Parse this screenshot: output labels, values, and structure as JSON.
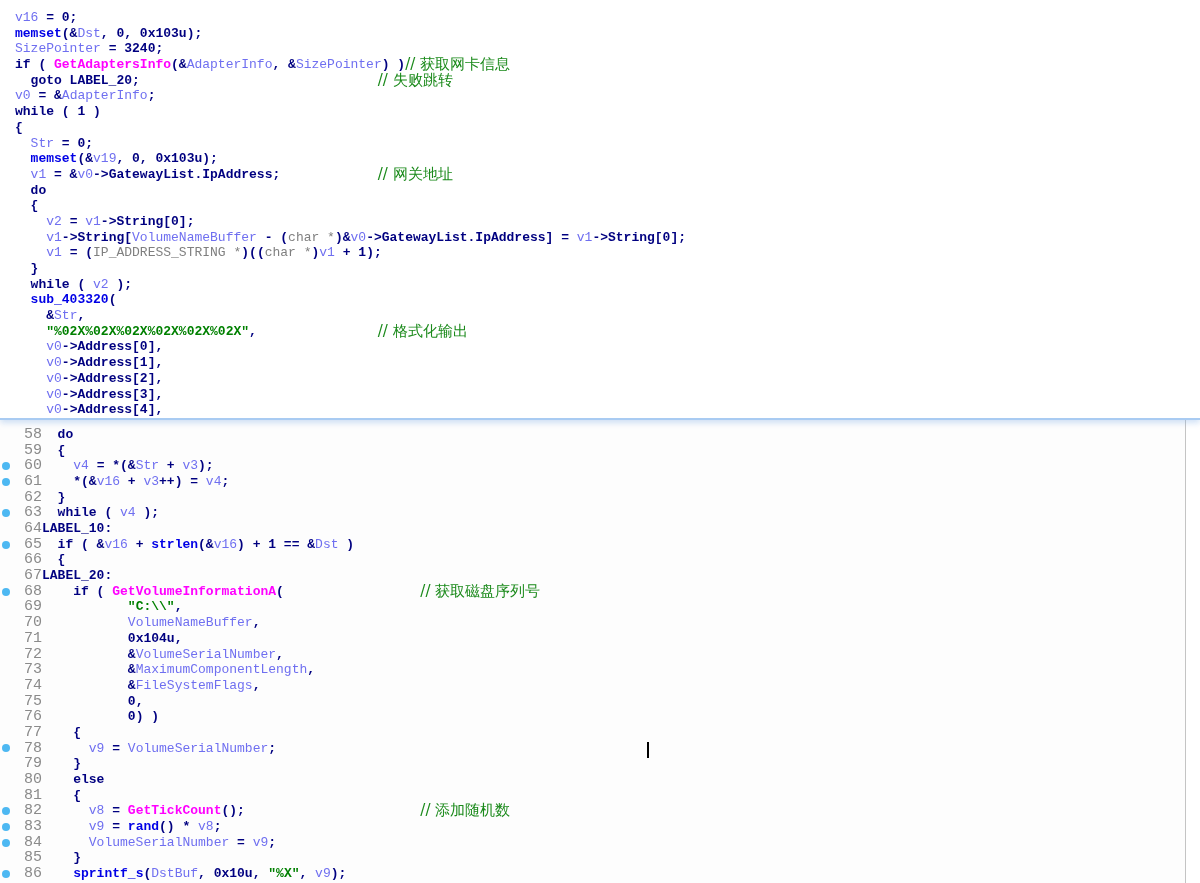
{
  "popup": {
    "lines": [
      {
        "code": [
          {
            "kind": "var",
            "text": "v16"
          },
          {
            "kind": "plain",
            "text": " = 0;"
          }
        ]
      },
      {
        "code": [
          {
            "kind": "func",
            "text": "memset"
          },
          {
            "kind": "plain",
            "text": "(&"
          },
          {
            "kind": "var",
            "text": "Dst"
          },
          {
            "kind": "plain",
            "text": ", 0, 0x103u);"
          }
        ]
      },
      {
        "code": [
          {
            "kind": "var",
            "text": "SizePointer"
          },
          {
            "kind": "plain",
            "text": " = 3240;"
          }
        ]
      },
      {
        "code": [
          {
            "kind": "plain",
            "text": "if ( "
          },
          {
            "kind": "import",
            "text": "GetAdaptersInfo"
          },
          {
            "kind": "plain",
            "text": "(&"
          },
          {
            "kind": "var",
            "text": "AdapterInfo"
          },
          {
            "kind": "plain",
            "text": ", &"
          },
          {
            "kind": "var",
            "text": "SizePointer"
          },
          {
            "kind": "plain",
            "text": ") )"
          }
        ],
        "comment": "// 获取网卡信息"
      },
      {
        "code": [
          {
            "kind": "plain",
            "text": "  goto LABEL_20;"
          }
        ],
        "comment": "// 失败跳转"
      },
      {
        "code": [
          {
            "kind": "var",
            "text": "v0"
          },
          {
            "kind": "plain",
            "text": " = &"
          },
          {
            "kind": "var",
            "text": "AdapterInfo"
          },
          {
            "kind": "plain",
            "text": ";"
          }
        ]
      },
      {
        "code": [
          {
            "kind": "plain",
            "text": "while ( 1 )"
          }
        ]
      },
      {
        "code": [
          {
            "kind": "plain",
            "text": "{"
          }
        ]
      },
      {
        "code": [
          {
            "kind": "var",
            "text": "  Str"
          },
          {
            "kind": "plain",
            "text": " = 0;"
          }
        ]
      },
      {
        "code": [
          {
            "kind": "func",
            "text": "  memset"
          },
          {
            "kind": "plain",
            "text": "(&"
          },
          {
            "kind": "var",
            "text": "v19"
          },
          {
            "kind": "plain",
            "text": ", 0, 0x103u);"
          }
        ]
      },
      {
        "code": [
          {
            "kind": "var",
            "text": "  v1"
          },
          {
            "kind": "plain",
            "text": " = &"
          },
          {
            "kind": "var",
            "text": "v0"
          },
          {
            "kind": "plain",
            "text": "->GatewayList.IpAddress;"
          }
        ],
        "comment": "// 网关地址"
      },
      {
        "code": [
          {
            "kind": "plain",
            "text": "  do"
          }
        ]
      },
      {
        "code": [
          {
            "kind": "plain",
            "text": "  {"
          }
        ]
      },
      {
        "code": [
          {
            "kind": "var",
            "text": "    v2"
          },
          {
            "kind": "plain",
            "text": " = "
          },
          {
            "kind": "var",
            "text": "v1"
          },
          {
            "kind": "plain",
            "text": "->String[0];"
          }
        ]
      },
      {
        "code": [
          {
            "kind": "var",
            "text": "    v1"
          },
          {
            "kind": "plain",
            "text": "->String["
          },
          {
            "kind": "var",
            "text": "VolumeNameBuffer"
          },
          {
            "kind": "plain",
            "text": " - ("
          },
          {
            "kind": "type",
            "text": "char *"
          },
          {
            "kind": "plain",
            "text": ")&"
          },
          {
            "kind": "var",
            "text": "v0"
          },
          {
            "kind": "plain",
            "text": "->GatewayList.IpAddress] = "
          },
          {
            "kind": "var",
            "text": "v1"
          },
          {
            "kind": "plain",
            "text": "->String[0];"
          }
        ]
      },
      {
        "code": [
          {
            "kind": "var",
            "text": "    v1"
          },
          {
            "kind": "plain",
            "text": " = ("
          },
          {
            "kind": "type",
            "text": "IP_ADDRESS_STRING *"
          },
          {
            "kind": "plain",
            "text": ")(("
          },
          {
            "kind": "type",
            "text": "char *"
          },
          {
            "kind": "plain",
            "text": ")"
          },
          {
            "kind": "var",
            "text": "v1"
          },
          {
            "kind": "plain",
            "text": " + 1);"
          }
        ]
      },
      {
        "code": [
          {
            "kind": "plain",
            "text": "  }"
          }
        ]
      },
      {
        "code": [
          {
            "kind": "plain",
            "text": "  while ( "
          },
          {
            "kind": "var",
            "text": "v2"
          },
          {
            "kind": "plain",
            "text": " );"
          }
        ]
      },
      {
        "code": [
          {
            "kind": "func",
            "text": "  sub_403320"
          },
          {
            "kind": "plain",
            "text": "("
          }
        ]
      },
      {
        "code": [
          {
            "kind": "plain",
            "text": "    &"
          },
          {
            "kind": "var",
            "text": "Str"
          },
          {
            "kind": "plain",
            "text": ","
          }
        ]
      },
      {
        "code": [
          {
            "kind": "string",
            "text": "    \"%02X%02X%02X%02X%02X%02X\""
          },
          {
            "kind": "plain",
            "text": ","
          }
        ],
        "comment": "// 格式化输出"
      },
      {
        "code": [
          {
            "kind": "var",
            "text": "    v0"
          },
          {
            "kind": "plain",
            "text": "->Address[0],"
          }
        ]
      },
      {
        "code": [
          {
            "kind": "var",
            "text": "    v0"
          },
          {
            "kind": "plain",
            "text": "->Address[1],"
          }
        ]
      },
      {
        "code": [
          {
            "kind": "var",
            "text": "    v0"
          },
          {
            "kind": "plain",
            "text": "->Address[2],"
          }
        ]
      },
      {
        "code": [
          {
            "kind": "var",
            "text": "    v0"
          },
          {
            "kind": "plain",
            "text": "->Address[3],"
          }
        ]
      },
      {
        "code": [
          {
            "kind": "var",
            "text": "    v0"
          },
          {
            "kind": "plain",
            "text": "->Address[4],"
          }
        ]
      }
    ]
  },
  "editor": {
    "lines": [
      {
        "number": "58",
        "breakpoint": false,
        "code": [
          {
            "kind": "plain",
            "text": "  do"
          }
        ]
      },
      {
        "number": "59",
        "breakpoint": false,
        "code": [
          {
            "kind": "plain",
            "text": "  {"
          }
        ]
      },
      {
        "number": "60",
        "breakpoint": true,
        "code": [
          {
            "kind": "var",
            "text": "    v4"
          },
          {
            "kind": "plain",
            "text": " = *(&"
          },
          {
            "kind": "var",
            "text": "Str"
          },
          {
            "kind": "plain",
            "text": " + "
          },
          {
            "kind": "var",
            "text": "v3"
          },
          {
            "kind": "plain",
            "text": ");"
          }
        ]
      },
      {
        "number": "61",
        "breakpoint": true,
        "code": [
          {
            "kind": "plain",
            "text": "    *(&"
          },
          {
            "kind": "var",
            "text": "v16"
          },
          {
            "kind": "plain",
            "text": " + "
          },
          {
            "kind": "var",
            "text": "v3"
          },
          {
            "kind": "plain",
            "text": "++) = "
          },
          {
            "kind": "var",
            "text": "v4"
          },
          {
            "kind": "plain",
            "text": ";"
          }
        ]
      },
      {
        "number": "62",
        "breakpoint": false,
        "code": [
          {
            "kind": "plain",
            "text": "  }"
          }
        ]
      },
      {
        "number": "63",
        "breakpoint": true,
        "code": [
          {
            "kind": "plain",
            "text": "  while ( "
          },
          {
            "kind": "var",
            "text": "v4"
          },
          {
            "kind": "plain",
            "text": " );"
          }
        ]
      },
      {
        "number": "64",
        "breakpoint": false,
        "code": [
          {
            "kind": "plain",
            "text": "LABEL_10:"
          }
        ]
      },
      {
        "number": "65",
        "breakpoint": true,
        "code": [
          {
            "kind": "plain",
            "text": "  if ( &"
          },
          {
            "kind": "var",
            "text": "v16"
          },
          {
            "kind": "plain",
            "text": " + "
          },
          {
            "kind": "func",
            "text": "strlen"
          },
          {
            "kind": "plain",
            "text": "(&"
          },
          {
            "kind": "var",
            "text": "v16"
          },
          {
            "kind": "plain",
            "text": ") + 1 == &"
          },
          {
            "kind": "var",
            "text": "Dst"
          },
          {
            "kind": "plain",
            "text": " )"
          }
        ]
      },
      {
        "number": "66",
        "breakpoint": false,
        "code": [
          {
            "kind": "plain",
            "text": "  {"
          }
        ]
      },
      {
        "number": "67",
        "breakpoint": false,
        "code": [
          {
            "kind": "plain",
            "text": "LABEL_20:"
          }
        ]
      },
      {
        "number": "68",
        "breakpoint": true,
        "code": [
          {
            "kind": "plain",
            "text": "    if ( "
          },
          {
            "kind": "import",
            "text": "GetVolumeInformationA"
          },
          {
            "kind": "plain",
            "text": "("
          }
        ],
        "comment": "// 获取磁盘序列号"
      },
      {
        "number": "69",
        "breakpoint": false,
        "code": [
          {
            "kind": "string",
            "text": "           \"C:\\\\\""
          },
          {
            "kind": "plain",
            "text": ","
          }
        ]
      },
      {
        "number": "70",
        "breakpoint": false,
        "code": [
          {
            "kind": "var",
            "text": "           VolumeNameBuffer"
          },
          {
            "kind": "plain",
            "text": ","
          }
        ]
      },
      {
        "number": "71",
        "breakpoint": false,
        "code": [
          {
            "kind": "plain",
            "text": "           0x104u,"
          }
        ]
      },
      {
        "number": "72",
        "breakpoint": false,
        "code": [
          {
            "kind": "plain",
            "text": "           &"
          },
          {
            "kind": "var",
            "text": "VolumeSerialNumber"
          },
          {
            "kind": "plain",
            "text": ","
          }
        ]
      },
      {
        "number": "73",
        "breakpoint": false,
        "code": [
          {
            "kind": "plain",
            "text": "           &"
          },
          {
            "kind": "var",
            "text": "MaximumComponentLength"
          },
          {
            "kind": "plain",
            "text": ","
          }
        ]
      },
      {
        "number": "74",
        "breakpoint": false,
        "code": [
          {
            "kind": "plain",
            "text": "           &"
          },
          {
            "kind": "var",
            "text": "FileSystemFlags"
          },
          {
            "kind": "plain",
            "text": ","
          }
        ]
      },
      {
        "number": "75",
        "breakpoint": false,
        "code": [
          {
            "kind": "plain",
            "text": "           0,"
          }
        ]
      },
      {
        "number": "76",
        "breakpoint": false,
        "code": [
          {
            "kind": "plain",
            "text": "           0) )"
          }
        ]
      },
      {
        "number": "77",
        "breakpoint": false,
        "code": [
          {
            "kind": "plain",
            "text": "    {"
          }
        ]
      },
      {
        "number": "78",
        "breakpoint": true,
        "code": [
          {
            "kind": "var",
            "text": "      v9"
          },
          {
            "kind": "plain",
            "text": " = "
          },
          {
            "kind": "var",
            "text": "VolumeSerialNumber"
          },
          {
            "kind": "plain",
            "text": ";"
          }
        ]
      },
      {
        "number": "79",
        "breakpoint": false,
        "code": [
          {
            "kind": "plain",
            "text": "    }"
          }
        ]
      },
      {
        "number": "80",
        "breakpoint": false,
        "code": [
          {
            "kind": "plain",
            "text": "    else"
          }
        ]
      },
      {
        "number": "81",
        "breakpoint": false,
        "code": [
          {
            "kind": "plain",
            "text": "    {"
          }
        ]
      },
      {
        "number": "82",
        "breakpoint": true,
        "code": [
          {
            "kind": "var",
            "text": "      v8"
          },
          {
            "kind": "plain",
            "text": " = "
          },
          {
            "kind": "import",
            "text": "GetTickCount"
          },
          {
            "kind": "plain",
            "text": "();"
          }
        ],
        "comment": "// 添加随机数"
      },
      {
        "number": "83",
        "breakpoint": true,
        "code": [
          {
            "kind": "var",
            "text": "      v9"
          },
          {
            "kind": "plain",
            "text": " = "
          },
          {
            "kind": "func",
            "text": "rand"
          },
          {
            "kind": "plain",
            "text": "() * "
          },
          {
            "kind": "var",
            "text": "v8"
          },
          {
            "kind": "plain",
            "text": ";"
          }
        ]
      },
      {
        "number": "84",
        "breakpoint": true,
        "code": [
          {
            "kind": "var",
            "text": "      VolumeSerialNumber"
          },
          {
            "kind": "plain",
            "text": " = "
          },
          {
            "kind": "var",
            "text": "v9"
          },
          {
            "kind": "plain",
            "text": ";"
          }
        ]
      },
      {
        "number": "85",
        "breakpoint": false,
        "code": [
          {
            "kind": "plain",
            "text": "    }"
          }
        ]
      },
      {
        "number": "86",
        "breakpoint": true,
        "code": [
          {
            "kind": "func",
            "text": "    sprintf_s"
          },
          {
            "kind": "plain",
            "text": "("
          },
          {
            "kind": "var",
            "text": "DstBuf"
          },
          {
            "kind": "plain",
            "text": ", 0x10u, "
          },
          {
            "kind": "string",
            "text": "\"%X\""
          },
          {
            "kind": "plain",
            "text": ", "
          },
          {
            "kind": "var",
            "text": "v9"
          },
          {
            "kind": "plain",
            "text": ");"
          }
        ]
      }
    ]
  }
}
